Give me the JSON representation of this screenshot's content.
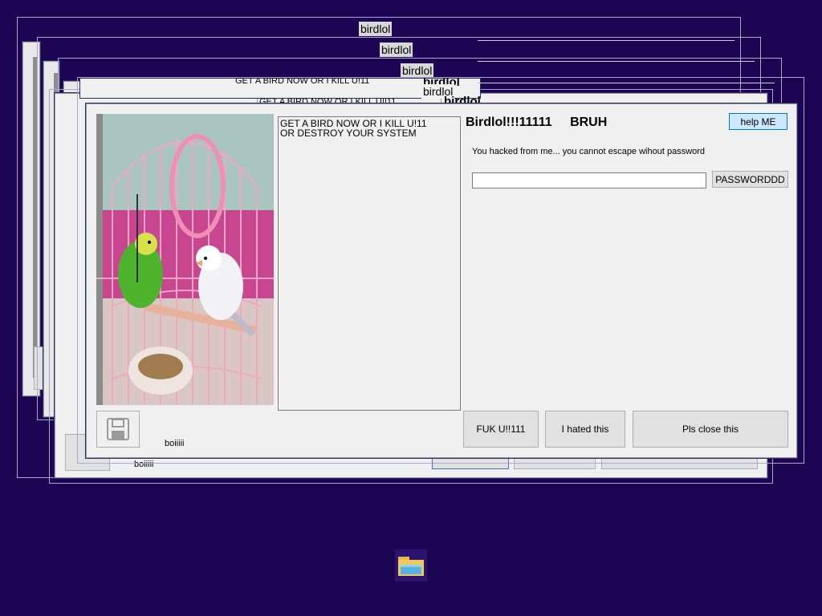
{
  "app": {
    "window_title": "birdlol",
    "back_titles": [
      "birdlol",
      "birdlol",
      "birdlol",
      "birdlol"
    ],
    "back_overlap_text": "birdlol"
  },
  "main_window": {
    "heading": "Birdlol!!!11111",
    "heading_suffix": "BRUH",
    "help_button": "help ME",
    "message": "You hacked from me... you cannot escape wihout password",
    "password_value": "",
    "password_button": "PASSWORDDD",
    "ransom_text_line1": "GET A BIRD NOW OR I KILL U!11",
    "ransom_text_line2": "OR DESTROY YOUR SYSTEM",
    "save_caption": "boiiiii",
    "buttons": {
      "fuk": "FUK U!!111",
      "hated": "I hated this",
      "close": "Pls close this"
    }
  },
  "back_windows": {
    "ransom_text": "GET A BIRD NOW OR I KILL U!11",
    "ransom_text_clipped": "GET A BIRD NOW OR I KILL U!!11",
    "caption": "boiiiii"
  },
  "taskbar": {
    "icon": "file-explorer-icon"
  },
  "colors": {
    "desktop": "#1d0553",
    "window_bg": "#f0f0f0",
    "help_button_bg": "#cce8ff",
    "help_button_border": "#0078d7"
  }
}
